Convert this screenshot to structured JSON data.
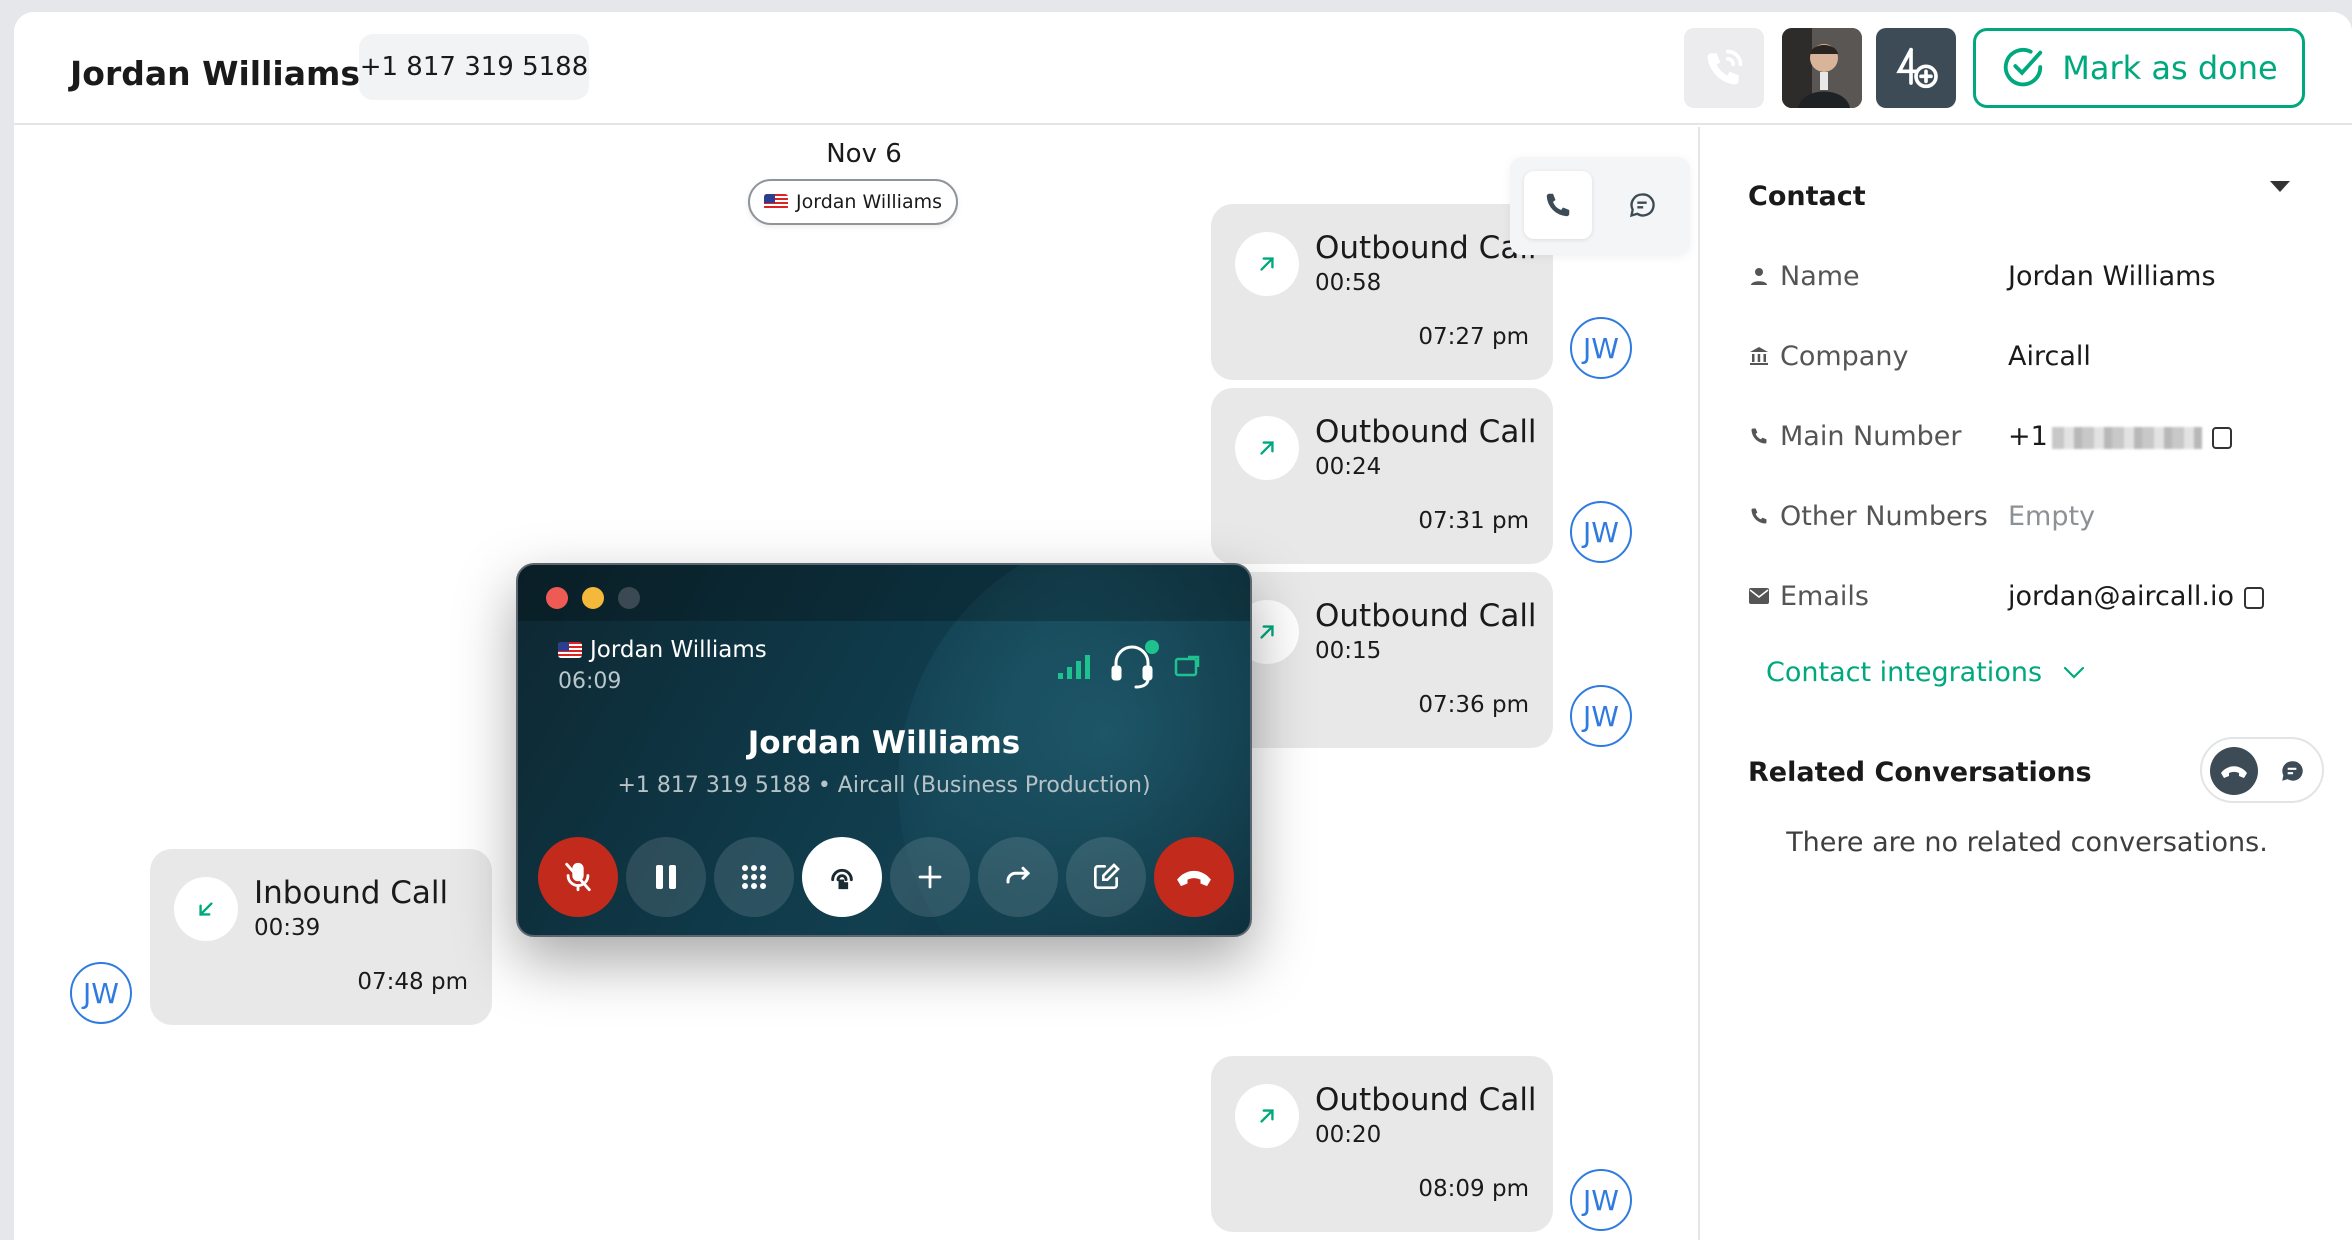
{
  "header": {
    "contact_name": "Jordan Williams",
    "phone": "+1 817 319 5188",
    "mark_done_label": "Mark as done"
  },
  "conversation": {
    "day_label": "Nov 6",
    "contact_chip": "Jordan Williams",
    "initials": "JW",
    "calls": [
      {
        "direction": "outbound",
        "title": "Outbound Call",
        "duration": "00:58",
        "time": "07:27 pm"
      },
      {
        "direction": "outbound",
        "title": "Outbound Call",
        "duration": "00:24",
        "time": "07:31 pm"
      },
      {
        "direction": "outbound",
        "title": "Outbound Call",
        "duration": "00:15",
        "time": "07:36 pm"
      },
      {
        "direction": "inbound",
        "title": "Inbound Call",
        "duration": "00:39",
        "time": "07:48 pm"
      },
      {
        "direction": "outbound",
        "title": "Outbound Call",
        "duration": "00:20",
        "time": "08:09 pm"
      }
    ]
  },
  "panel": {
    "contact_title": "Contact",
    "fields": [
      {
        "label": "Name",
        "value": "Jordan Williams",
        "icon": "person-icon"
      },
      {
        "label": "Company",
        "value": "Aircall",
        "icon": "building-icon"
      },
      {
        "label": "Main Number",
        "value": "+1",
        "icon": "phone-icon"
      },
      {
        "label": "Other Numbers",
        "value": "Empty",
        "icon": "phone-icon"
      },
      {
        "label": "Emails",
        "value": "jordan@aircall.io",
        "icon": "mail-icon"
      }
    ],
    "integrations_label": "Contact integrations",
    "related_title": "Related Conversations",
    "no_related": "There are no related conversations."
  },
  "call_widget": {
    "caller": "Jordan Williams",
    "timer": "06:09",
    "name": "Jordan Williams",
    "subtitle": "+1 817 319 5188 • Aircall (Business Production)"
  },
  "colors": {
    "accent_green": "#00a87e",
    "avatar_blue": "#2f7be0",
    "danger_red": "#c22a1c",
    "dark_slate": "#3c4b55"
  }
}
